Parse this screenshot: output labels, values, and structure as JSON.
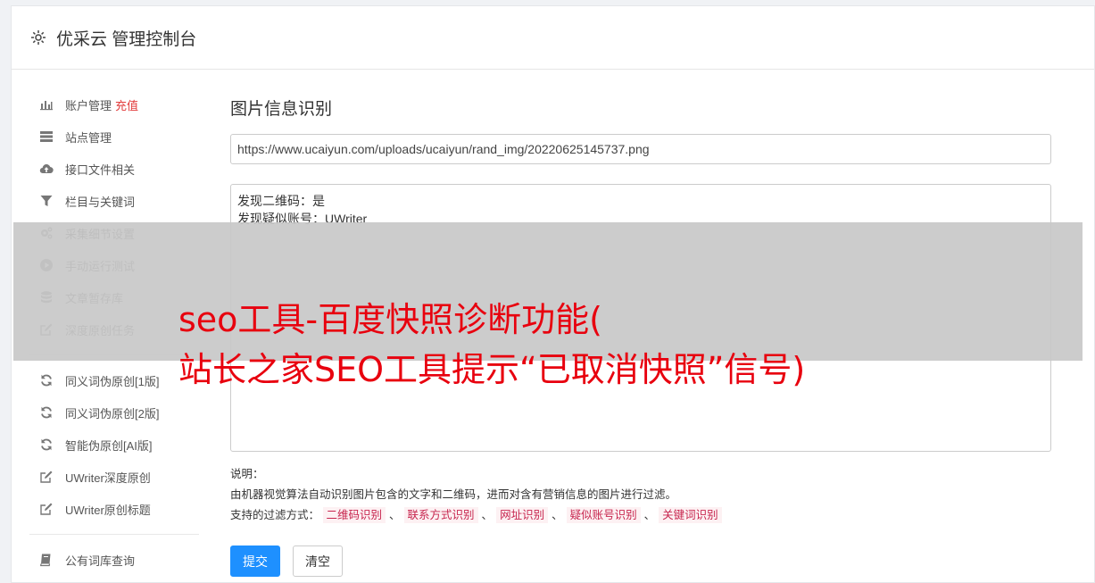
{
  "header": {
    "title": "优采云 管理控制台",
    "icon": "gear-icon"
  },
  "sidebar": {
    "group1": [
      {
        "label": "账户管理",
        "badge": "充值",
        "icon": "bar-chart-icon"
      },
      {
        "label": "站点管理",
        "icon": "server-icon"
      },
      {
        "label": "接口文件相关",
        "icon": "cloud-upload-icon"
      },
      {
        "label": "栏目与关键词",
        "icon": "filter-icon"
      },
      {
        "label": "采集细节设置",
        "icon": "cogs-icon"
      },
      {
        "label": "手动运行测试",
        "icon": "play-circle-icon"
      },
      {
        "label": "文章暂存库",
        "icon": "database-icon"
      },
      {
        "label": "深度原创任务",
        "icon": "edit-icon"
      }
    ],
    "group2": [
      {
        "label": "同义词伪原创[1版]",
        "icon": "refresh-icon"
      },
      {
        "label": "同义词伪原创[2版]",
        "icon": "refresh-icon"
      },
      {
        "label": "智能伪原创[AI版]",
        "icon": "refresh-icon"
      },
      {
        "label": "UWriter深度原创",
        "icon": "edit-icon"
      },
      {
        "label": "UWriter原创标题",
        "icon": "edit-icon"
      }
    ],
    "group3": [
      {
        "label": "公有词库查询",
        "icon": "book-icon"
      }
    ]
  },
  "main": {
    "heading": "图片信息识别",
    "url_value": "https://www.ucaiyun.com/uploads/ucaiyun/rand_img/20220625145737.png",
    "result_lines": [
      "发现二维码：是",
      "发现疑似账号：UWriter"
    ],
    "desc_title": "说明：",
    "desc_text": "由机器视觉算法自动识别图片包含的文字和二维码，进而对含有营销信息的图片进行过滤。",
    "filter_label": "支持的过滤方式：",
    "filters": [
      "二维码识别",
      "联系方式识别",
      "网址识别",
      "疑似账号识别",
      "关键词识别"
    ],
    "filter_sep": "、",
    "submit_label": "提交",
    "clear_label": "清空"
  },
  "overlay": {
    "line1": "seo工具-百度快照诊断功能(",
    "line2": "站长之家SEO工具提示“已取消快照”信号)"
  },
  "colors": {
    "primary": "#1e90ff",
    "badge": "#e23b3b",
    "tag_text": "#c7254e",
    "tag_bg": "#fdf1f3",
    "overlay_text": "#e8000e"
  }
}
